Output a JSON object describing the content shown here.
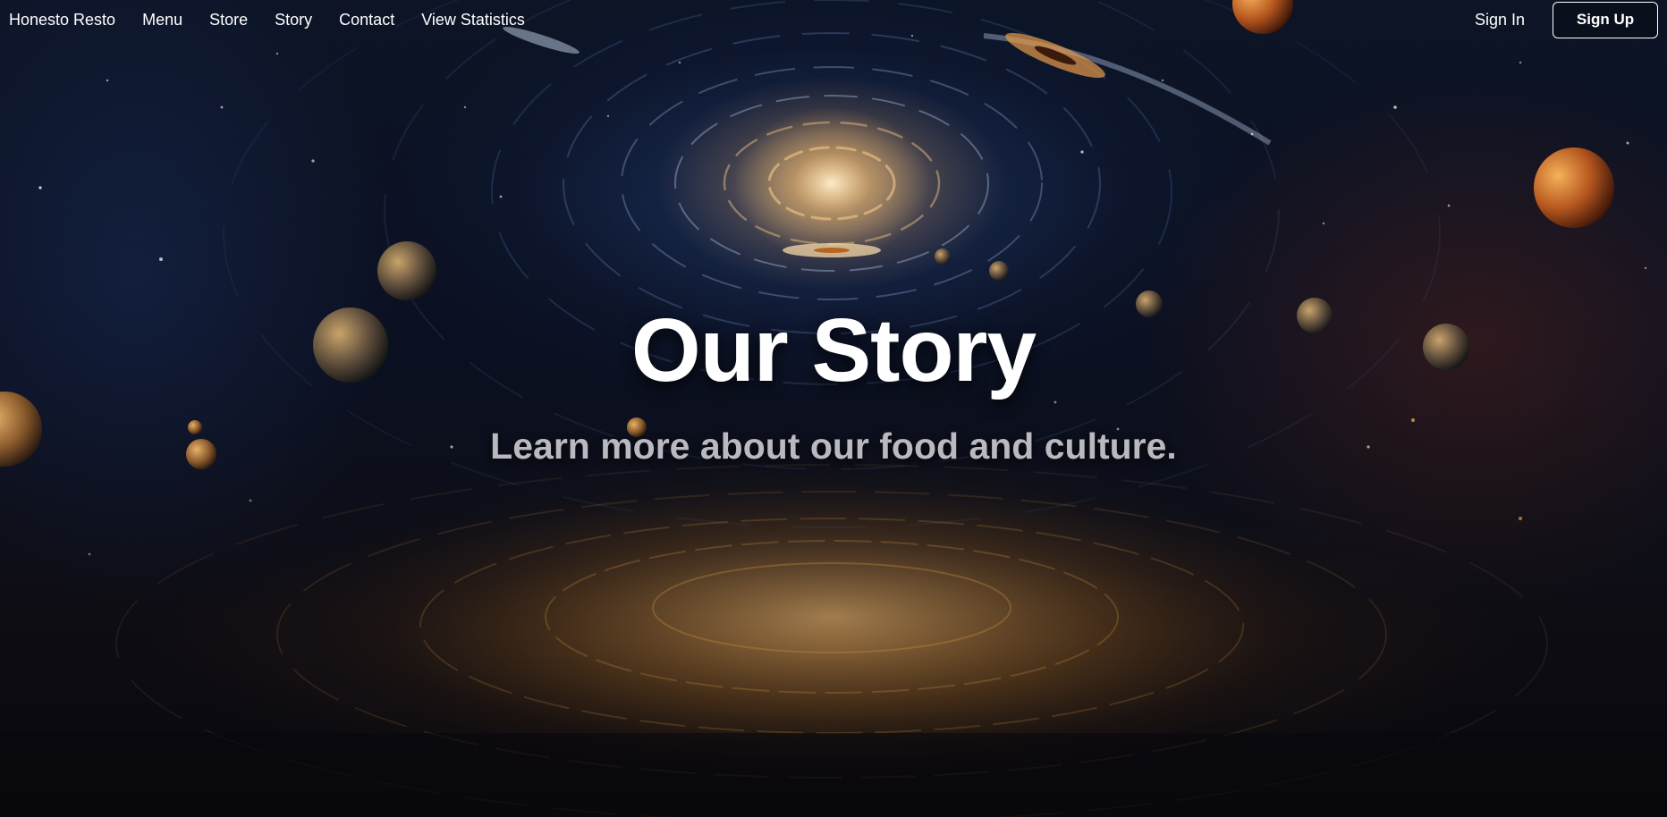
{
  "nav": {
    "brand": "Honesto Resto",
    "links": [
      "Menu",
      "Store",
      "Story",
      "Contact",
      "View Statistics"
    ],
    "sign_in": "Sign In",
    "sign_up": "Sign Up"
  },
  "hero": {
    "title": "Our Story",
    "subtitle": "Learn more about our food and culture."
  },
  "background": {
    "description_icon": "space-galaxy-background-image"
  }
}
